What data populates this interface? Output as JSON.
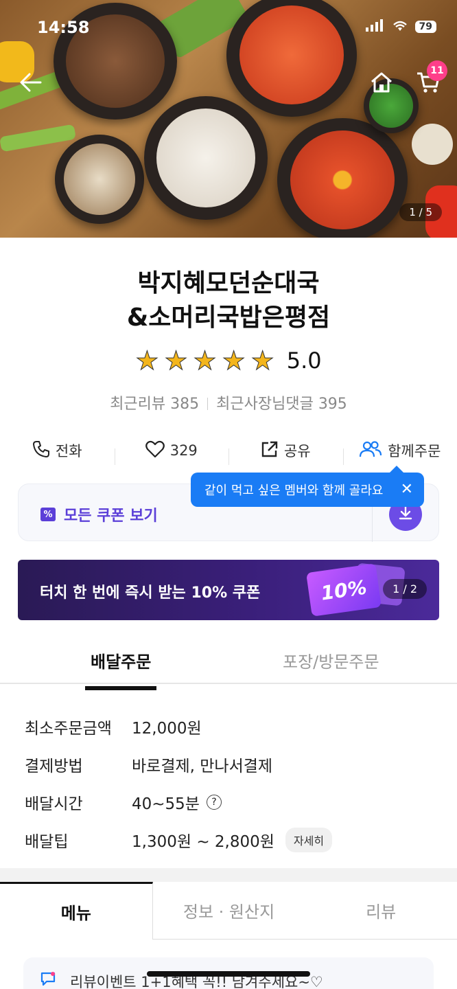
{
  "status": {
    "time": "14:58",
    "battery": "79"
  },
  "header": {
    "cart_count": "11",
    "image_pager": "1 / 5"
  },
  "store": {
    "name_line1": "박지혜모던순대국",
    "name_line2": "&소머리국밥은평점",
    "rating": "5.0",
    "stars": 5,
    "recent_reviews": "최근리뷰 385",
    "owner_replies": "최근사장님댓글 395"
  },
  "actions": {
    "call": "전화",
    "likes": "329",
    "share": "공유",
    "group_order": "함께주문"
  },
  "tooltip": {
    "text": "같이 먹고 싶은 멤버와 함께 골라요"
  },
  "coupon": {
    "label": "모든 쿠폰 보기",
    "icon": "%"
  },
  "banner": {
    "text": "터치 한 번에 즉시 받는 10% 쿠폰",
    "ticket": "10%",
    "pager": "1 / 2"
  },
  "order_tabs": {
    "delivery": "배달주문",
    "pickup": "포장/방문주문"
  },
  "delivery_info": [
    {
      "key": "최소주문금액",
      "value": "12,000원"
    },
    {
      "key": "결제방법",
      "value": "바로결제, 만나서결제"
    },
    {
      "key": "배달시간",
      "value": "40~55분"
    },
    {
      "key": "배달팁",
      "value": "1,300원 ~ 2,800원",
      "button": "자세히"
    }
  ],
  "menu_tabs": {
    "menu": "메뉴",
    "info": "정보 · 원산지",
    "review": "리뷰"
  },
  "event": {
    "text": "리뷰이벤트 1+1혜택 꼭!! 남겨주세요~♡"
  },
  "colors": {
    "accent": "#5b3fd8",
    "tooltip": "#1a7cf5",
    "star": "#f3b51c",
    "badge": "#ff3e8a"
  }
}
